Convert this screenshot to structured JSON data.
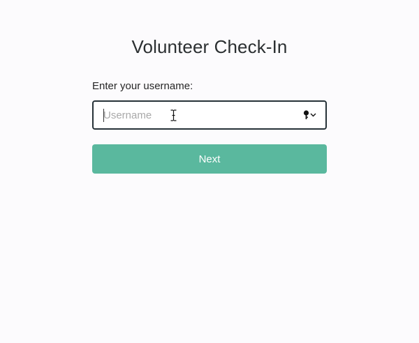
{
  "page": {
    "title": "Volunteer Check-In"
  },
  "form": {
    "username_label": "Enter your username:",
    "username_value": "",
    "username_placeholder": "Username",
    "next_label": "Next"
  },
  "icons": {
    "text_cursor": "i-beam-cursor-icon",
    "password_manager": "key-icon",
    "dropdown": "chevron-down-icon"
  },
  "colors": {
    "background": "#fcfbfd",
    "input_border": "#263238",
    "button_background": "#5ab89e",
    "button_text": "#ffffff",
    "placeholder": "#a9a9a9"
  }
}
